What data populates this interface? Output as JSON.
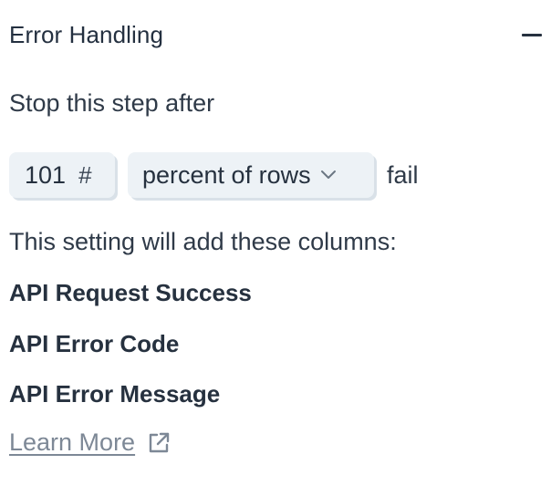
{
  "section": {
    "title": "Error Handling",
    "collapse_icon": "minus-icon"
  },
  "stop_rule": {
    "label": "Stop this step after",
    "threshold_value": "101",
    "threshold_icon": "#",
    "unit_selected": "percent of rows",
    "unit_icon": "chevron-down-icon",
    "suffix": "fail"
  },
  "columns": {
    "intro": "This setting will add these columns:",
    "items": [
      "API Request Success",
      "API Error Code",
      "API Error Message"
    ]
  },
  "learn_more": {
    "label": "Learn More",
    "icon": "external-link-icon"
  },
  "colors": {
    "text": "#26313f",
    "field_bg": "#edf2f6",
    "link": "#7d8896"
  }
}
